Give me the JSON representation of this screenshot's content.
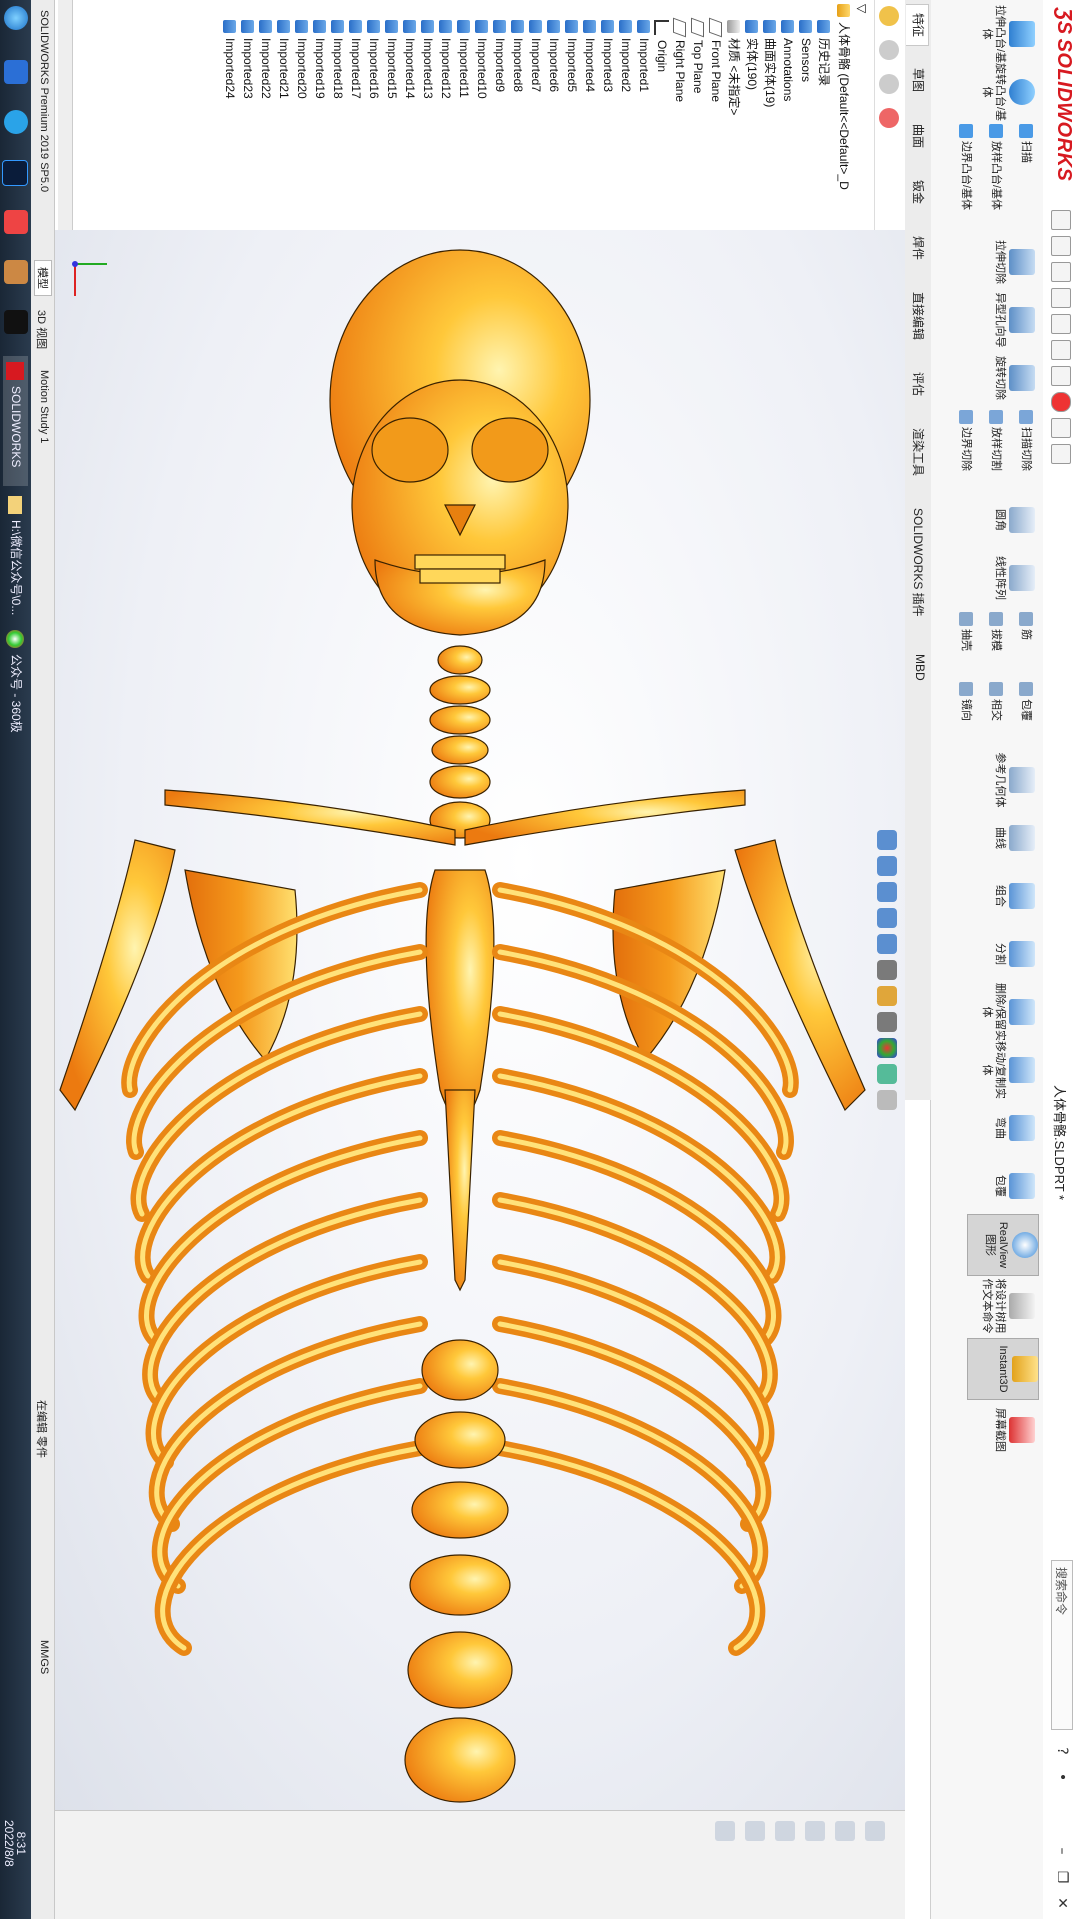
{
  "app": {
    "brand": "SOLIDWORKS",
    "document_title": "人体骨骼.SLDPRT *",
    "search_placeholder": "搜索命令"
  },
  "ribbon": {
    "features": [
      {
        "label": "拉伸凸台/基体"
      },
      {
        "label": "旋转凸台/基体"
      },
      {
        "label": "扫描"
      },
      {
        "label": "放样凸台/基体"
      },
      {
        "label": "边界凸台/基体"
      },
      {
        "label": "拉伸切除"
      },
      {
        "label": "异型孔向导"
      },
      {
        "label": "旋转切除"
      },
      {
        "label": "扫描切除"
      },
      {
        "label": "放样切割"
      },
      {
        "label": "边界切除"
      },
      {
        "label": "圆角"
      },
      {
        "label": "线性阵列"
      },
      {
        "label": "筋"
      },
      {
        "label": "拔模"
      },
      {
        "label": "抽壳"
      },
      {
        "label": "包覆"
      },
      {
        "label": "相交"
      },
      {
        "label": "镜向"
      },
      {
        "label": "参考几何体"
      },
      {
        "label": "曲线"
      },
      {
        "label": "组合"
      },
      {
        "label": "分割"
      },
      {
        "label": "删除/保留实体"
      },
      {
        "label": "移动/复制实体"
      },
      {
        "label": "弯曲"
      },
      {
        "label": "包覆"
      },
      {
        "label": "RealView 图形"
      },
      {
        "label": "将设计树用作文本命令"
      },
      {
        "label": "Instant3D"
      },
      {
        "label": "屏幕截图"
      }
    ]
  },
  "tabs": [
    "特征",
    "草图",
    "曲面",
    "钣金",
    "焊件",
    "直接编辑",
    "评估",
    "渲染工具",
    "SOLIDWORKS 插件",
    "MBD"
  ],
  "feature_tree": {
    "root": "人体骨骼 (Default<<Default>_D",
    "items": [
      "历史记录",
      "Sensors",
      "Annotations",
      "曲面实体(19)",
      "实体(190)",
      "材质 <未指定>",
      "Front Plane",
      "Top Plane",
      "Right Plane",
      "Origin",
      "Imported1",
      "Imported2",
      "Imported3",
      "Imported4",
      "Imported5",
      "Imported6",
      "Imported7",
      "Imported8",
      "Imported9",
      "Imported10",
      "Imported11",
      "Imported12",
      "Imported13",
      "Imported14",
      "Imported15",
      "Imported16",
      "Imported17",
      "Imported18",
      "Imported19",
      "Imported20",
      "Imported21",
      "Imported22",
      "Imported23",
      "Imported24"
    ]
  },
  "bottom_tabs": [
    "模型",
    "3D 视图",
    "Motion Study 1"
  ],
  "status": {
    "edit_state": "在编辑 零件",
    "units": "MMGS"
  },
  "taskbar": {
    "items": [
      {
        "label": "SOLIDWORKS P..."
      },
      {
        "label": "H:\\微信公众号\\0..."
      },
      {
        "label": "公众号 - 360极速..."
      }
    ],
    "clock_time": "8:31",
    "clock_date": "2022/8/8",
    "status_text": "SOLIDWORKS Premium 2019 SP5.0"
  },
  "colors": {
    "bone": "#f08a1a",
    "bone_highlight": "#ffd24a",
    "brand": "#d71920"
  }
}
